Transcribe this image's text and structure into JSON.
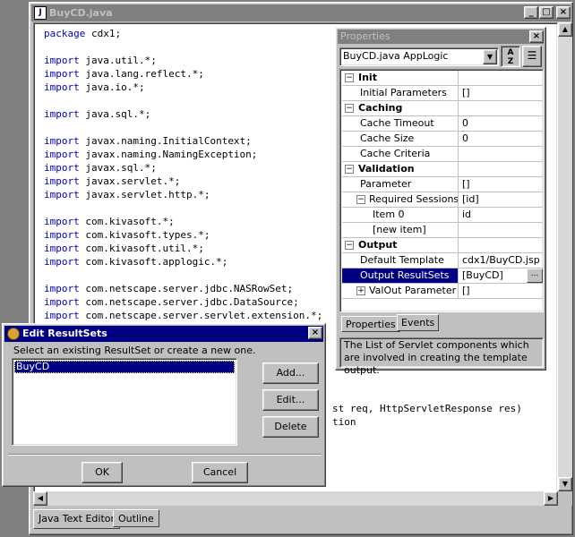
{
  "editor": {
    "title": "BuyCD.java",
    "code_lines": [
      "package cdx1;",
      "",
      "import java.util.*;",
      "import java.lang.reflect.*;",
      "import java.io.*;",
      "",
      "import java.sql.*;",
      "",
      "import javax.naming.InitialContext;",
      "import javax.naming.NamingException;",
      "import javax.sql.*;",
      "import javax.servlet.*;",
      "import javax.servlet.http.*;",
      "",
      "import com.kivasoft.*;",
      "import com.kivasoft.types.*;",
      "import com.kivasoft.util.*;",
      "import com.kivasoft.applogic.*;",
      "",
      "import com.netscape.server.jdbc.NASRowSet;",
      "import com.netscape.server.jdbc.DataSource;",
      "import com.netscape.server.servlet.extension.*;"
    ],
    "partial_line_1": "st req, HttpServletResponse res)",
    "partial_line_2": "tion",
    "bottom_tabs": [
      "Java Text Editor",
      "Outline"
    ]
  },
  "properties": {
    "title": "Properties",
    "combo_value": "BuyCD.java AppLogic",
    "rows": [
      {
        "name": "Init",
        "value": "",
        "kind": "cat",
        "expander": "−"
      },
      {
        "name": "Initial Parameters",
        "value": "[]",
        "kind": "prop"
      },
      {
        "name": "Caching",
        "value": "",
        "kind": "cat",
        "expander": "−"
      },
      {
        "name": "Cache Timeout",
        "value": "0",
        "kind": "prop"
      },
      {
        "name": "Cache Size",
        "value": "0",
        "kind": "prop"
      },
      {
        "name": "Cache Criteria",
        "value": "",
        "kind": "prop"
      },
      {
        "name": "Validation",
        "value": "",
        "kind": "cat",
        "expander": "−"
      },
      {
        "name": "Parameter",
        "value": "[]",
        "kind": "prop"
      },
      {
        "name": "Required Sessions",
        "value": "[id]",
        "kind": "prop",
        "expander": "−"
      },
      {
        "name": "Item 0",
        "value": "id",
        "kind": "sub"
      },
      {
        "name": "[new item]",
        "value": "",
        "kind": "sub"
      },
      {
        "name": "Output",
        "value": "",
        "kind": "cat",
        "expander": "−"
      },
      {
        "name": "Default Template",
        "value": "cdx1/BuyCD.jsp",
        "kind": "prop"
      },
      {
        "name": "Output ResultSets",
        "value": "[BuyCD]",
        "kind": "prop",
        "selected": true
      },
      {
        "name": "ValOut Parameter",
        "value": "[]",
        "kind": "prop",
        "expander": "+"
      }
    ],
    "tabs": [
      "Properties",
      "Events"
    ],
    "description": "The List of Servlet components which are involved in creating the template output."
  },
  "dialog": {
    "title": "Edit ResultSets",
    "prompt": "Select an existing ResultSet or create a new one.",
    "list_items": [
      "BuyCD"
    ],
    "add_label": "Add...",
    "edit_label": "Edit...",
    "delete_label": "Delete",
    "ok_label": "OK",
    "cancel_label": "Cancel"
  },
  "colors": {
    "selection": "#000080",
    "keyword": "#0000c0",
    "face": "#c0c0c0"
  }
}
